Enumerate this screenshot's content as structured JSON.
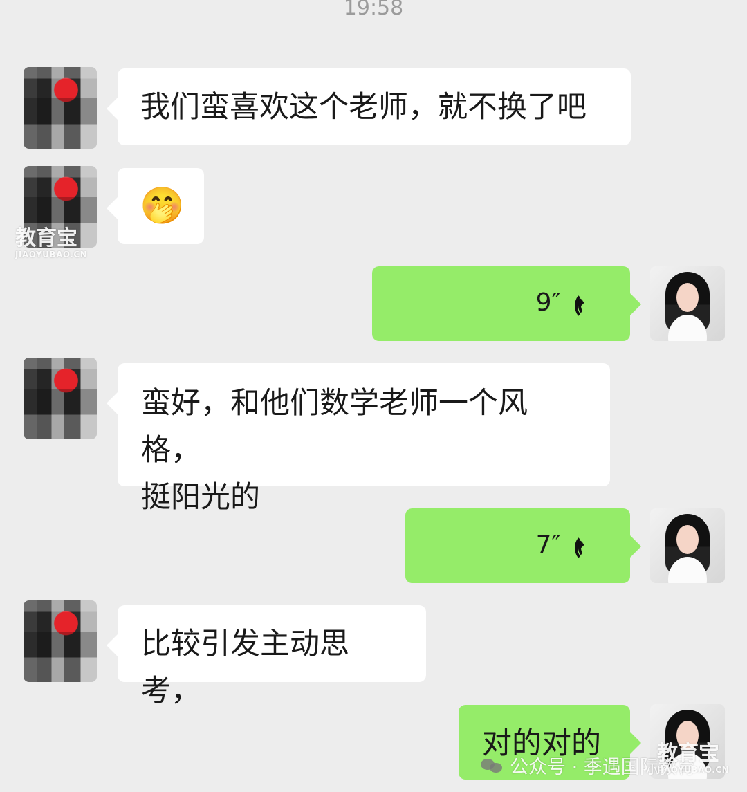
{
  "chat": {
    "timestamp": "19:58",
    "messages": [
      {
        "sender": "contact",
        "type": "text",
        "text": "我们蛮喜欢这个老师，就不换了吧"
      },
      {
        "sender": "contact",
        "type": "emoji",
        "emoji_name": "covering-mouth-emoji",
        "emoji": "🤭"
      },
      {
        "sender": "self",
        "type": "voice",
        "duration": "9″"
      },
      {
        "sender": "contact",
        "type": "text",
        "text": "蛮好，和他们数学老师一个风格，\n挺阳光的"
      },
      {
        "sender": "self",
        "type": "voice",
        "duration": "7″"
      },
      {
        "sender": "contact",
        "type": "text",
        "text": "比较引发主动思考，"
      },
      {
        "sender": "self",
        "type": "text",
        "text": "对的对的"
      }
    ]
  },
  "overlays": {
    "watermark_main": "教育宝",
    "watermark_sub": "JIAOYUBAO.CN",
    "source_label": "公众号 · 季遇国际教育"
  },
  "colors": {
    "background": "#ededed",
    "contact_bubble": "#ffffff",
    "self_bubble": "#95ec69",
    "text": "#191919",
    "timestamp": "#9b9b9b"
  }
}
